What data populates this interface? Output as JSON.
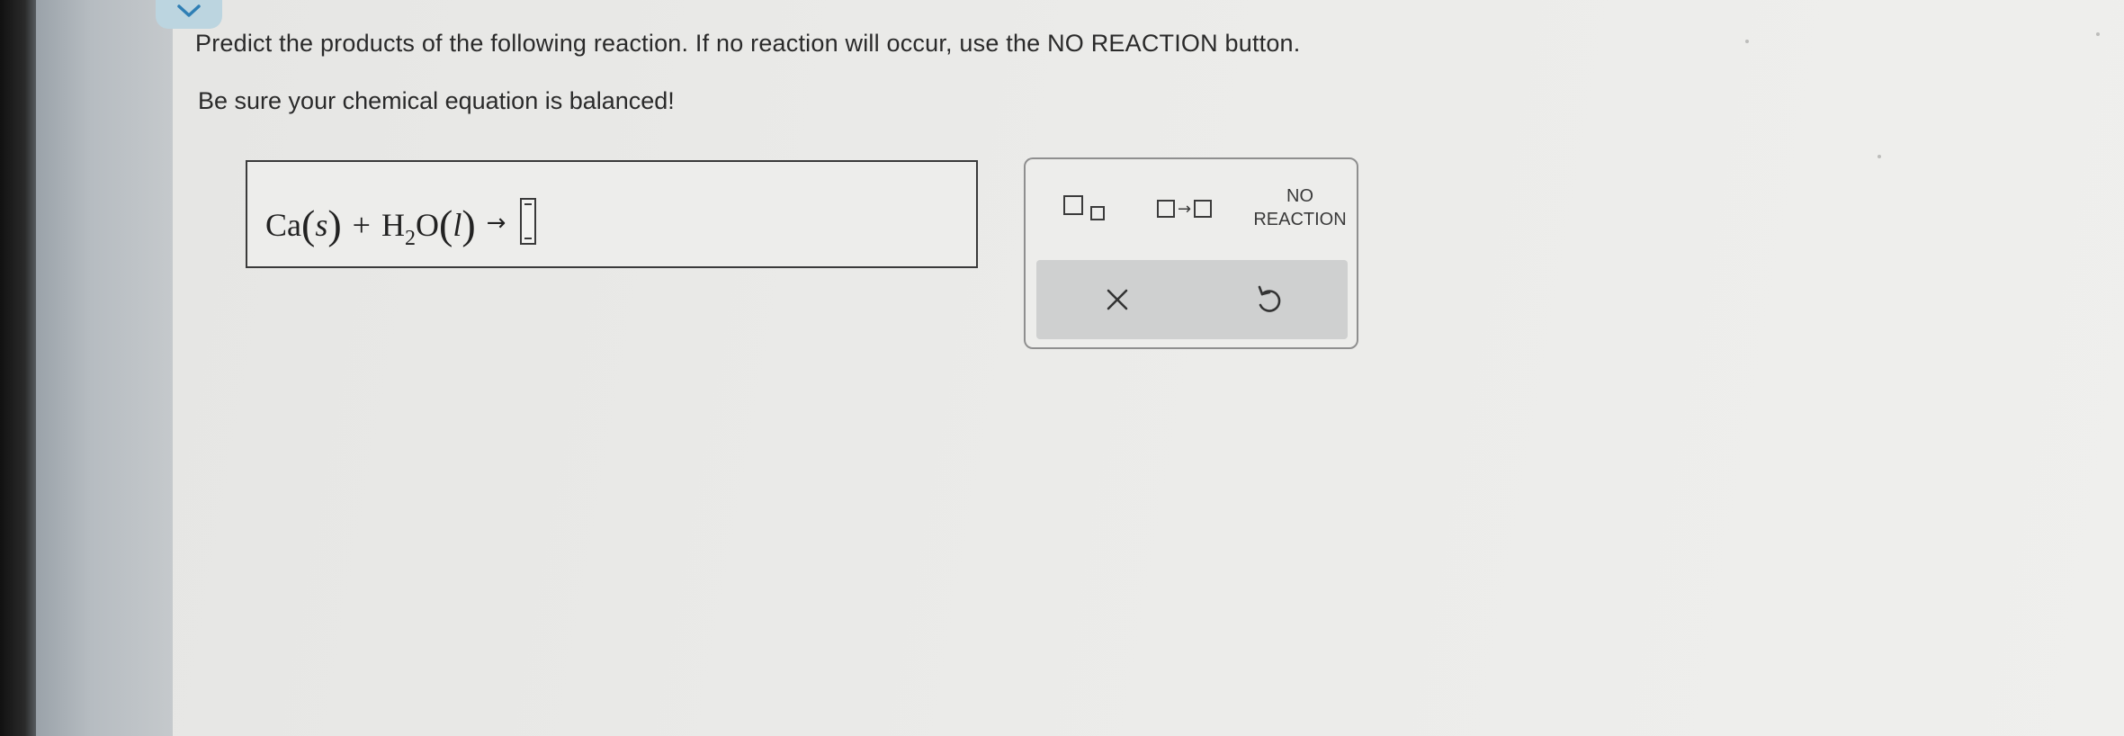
{
  "question": {
    "prompt": "Predict the products of the following reaction. If no reaction will occur, use the NO REACTION button.",
    "note": "Be sure your chemical equation is balanced!"
  },
  "equation": {
    "reactant1_symbol": "Ca",
    "reactant1_state": "s",
    "plus": "+",
    "reactant2_symbol": "H",
    "reactant2_subscript": "2",
    "reactant2_symbol_rest": "O",
    "reactant2_state": "l",
    "arrow": "→",
    "open_paren": "(",
    "close_paren": ")"
  },
  "toolbar": {
    "no_reaction_line1": "NO",
    "no_reaction_line2": "REACTION",
    "arrow_glyph": "→"
  },
  "colors": {
    "tab_accent": "#bcd5e0",
    "chevron": "#2f7fb5",
    "action_bar": "#cfd0d0"
  },
  "icons": {
    "subscript_tool": "subscript-box-icon",
    "reaction_arrow_tool": "reaction-arrow-icon",
    "clear": "close-x-icon",
    "undo": "undo-icon",
    "collapse": "chevron-down-icon"
  }
}
